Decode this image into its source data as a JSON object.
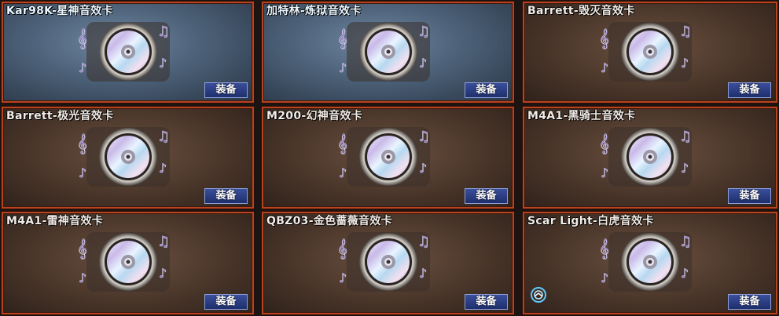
{
  "cards": [
    {
      "title": "Kar98K-星神音效卡",
      "theme": "blue",
      "equip": "装备"
    },
    {
      "title": "加特林-炼狱音效卡",
      "theme": "blue",
      "equip": "装备"
    },
    {
      "title": "Barrett-毁灭音效卡",
      "theme": "brown",
      "equip": "装备"
    },
    {
      "title": "Barrett-极光音效卡",
      "theme": "brown",
      "equip": "装备"
    },
    {
      "title": "M200-幻神音效卡",
      "theme": "brown",
      "equip": "装备"
    },
    {
      "title": "M4A1-黑骑士音效卡",
      "theme": "brown",
      "equip": "装备"
    },
    {
      "title": "M4A1-雷神音效卡",
      "theme": "brown",
      "equip": "装备"
    },
    {
      "title": "QBZ03-金色蔷薇音效卡",
      "theme": "brown",
      "equip": "装备"
    },
    {
      "title": "Scar Light-白虎音效卡",
      "theme": "brown",
      "equip": "装备",
      "badge_icon": "equipped-badge-icon"
    }
  ],
  "colors": {
    "border": "#b8431f",
    "button": "#2a3c85"
  }
}
